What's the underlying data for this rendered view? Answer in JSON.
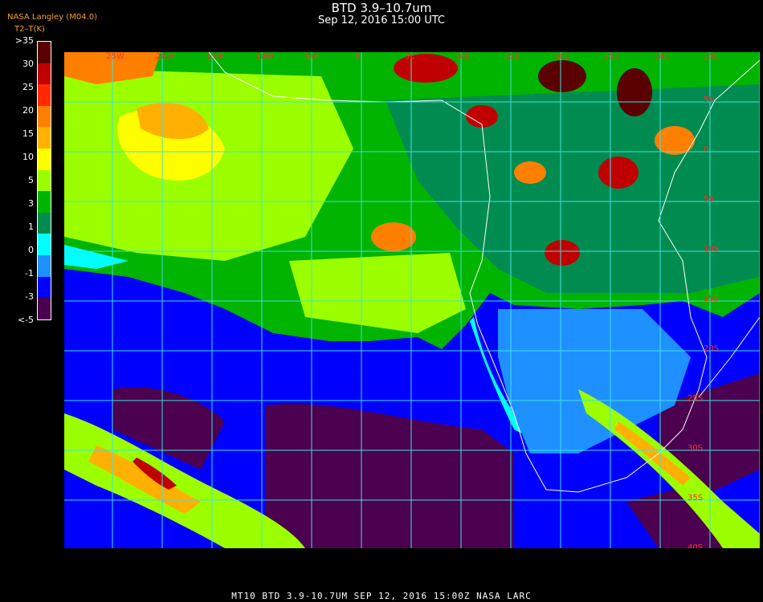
{
  "header": {
    "title": "BTD 3.9–10.7um",
    "subtitle": "Sep 12, 2016 15:00 UTC",
    "org": "NASA Langley (M04.0)",
    "legend_title": "T2–T(K)"
  },
  "legend": {
    "ticks": [
      ">35",
      "30",
      "25",
      "20",
      "15",
      "10",
      "5",
      "3",
      "1",
      "0",
      "-1",
      "-3",
      "<-5"
    ],
    "colors": [
      "#5a0000",
      "#c00000",
      "#ff2a00",
      "#ff7f00",
      "#ffb000",
      "#ffff00",
      "#9cff00",
      "#00b400",
      "#008c50",
      "#00ffff",
      "#1e90ff",
      "#0000ff",
      "#4b0050"
    ]
  },
  "map": {
    "lat_labels": [
      "5N",
      "0",
      "5S",
      "10S",
      "15S",
      "20S",
      "25S",
      "30S",
      "35S",
      "40S"
    ],
    "lon_labels": [
      "25W",
      "20W",
      "15W",
      "10W",
      "5W",
      "0",
      "5E",
      "10E",
      "15E",
      "20E",
      "25E",
      "30E",
      "35E"
    ],
    "colors": {
      "ocean_clear": "#4b0050",
      "ocean": "#0000ff",
      "land_green": "#00b400",
      "land_lime": "#9cff00",
      "land_teal": "#008c50",
      "cloud_hot": "#c00000",
      "grid": "#40e0e0",
      "lat_label": "#ff3030"
    }
  },
  "footer": {
    "text": "MT10  BTD 3.9-10.7UM   SEP 12, 2016 15:00Z   NASA LARC"
  }
}
